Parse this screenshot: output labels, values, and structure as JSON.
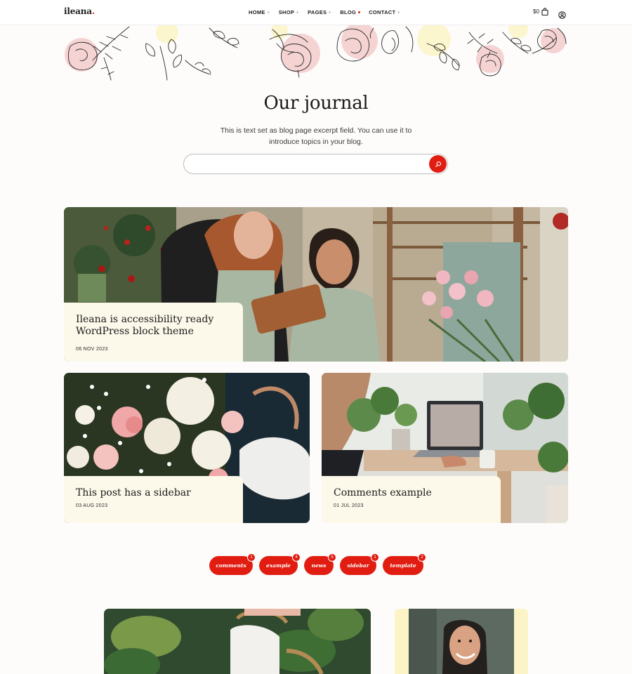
{
  "header": {
    "logo": "ileana",
    "logo_dot": ".",
    "nav": [
      {
        "label": "HOME",
        "suffix": "plus"
      },
      {
        "label": "SHOP",
        "suffix": "plus"
      },
      {
        "label": "PAGES",
        "suffix": "plus"
      },
      {
        "label": "BLOG",
        "suffix": "red-dot"
      },
      {
        "label": "CONTACT",
        "suffix": "plus"
      }
    ],
    "cart_total": "$0",
    "accent": "#e11d12"
  },
  "page": {
    "title": "Our journal",
    "excerpt": "This is text set as blog page excerpt field. You can use it to introduce topics in your blog.",
    "search_placeholder": ""
  },
  "posts": [
    {
      "title": "Ileana is accessibility ready WordPress block theme",
      "date": "06 NOV 2023",
      "image": "florists-with-tablet-photo"
    },
    {
      "title": "This post has a sidebar",
      "date": "03 AUG 2023",
      "image": "pink-white-bouquet-photo"
    },
    {
      "title": "Comments example",
      "date": "01 JUL 2023",
      "image": "laptop-desk-plants-photo"
    }
  ],
  "tags": [
    {
      "label": "comments",
      "count": "1"
    },
    {
      "label": "example",
      "count": "4"
    },
    {
      "label": "news",
      "count": "5"
    },
    {
      "label": "sidebar",
      "count": "1"
    },
    {
      "label": "template",
      "count": "2"
    }
  ]
}
